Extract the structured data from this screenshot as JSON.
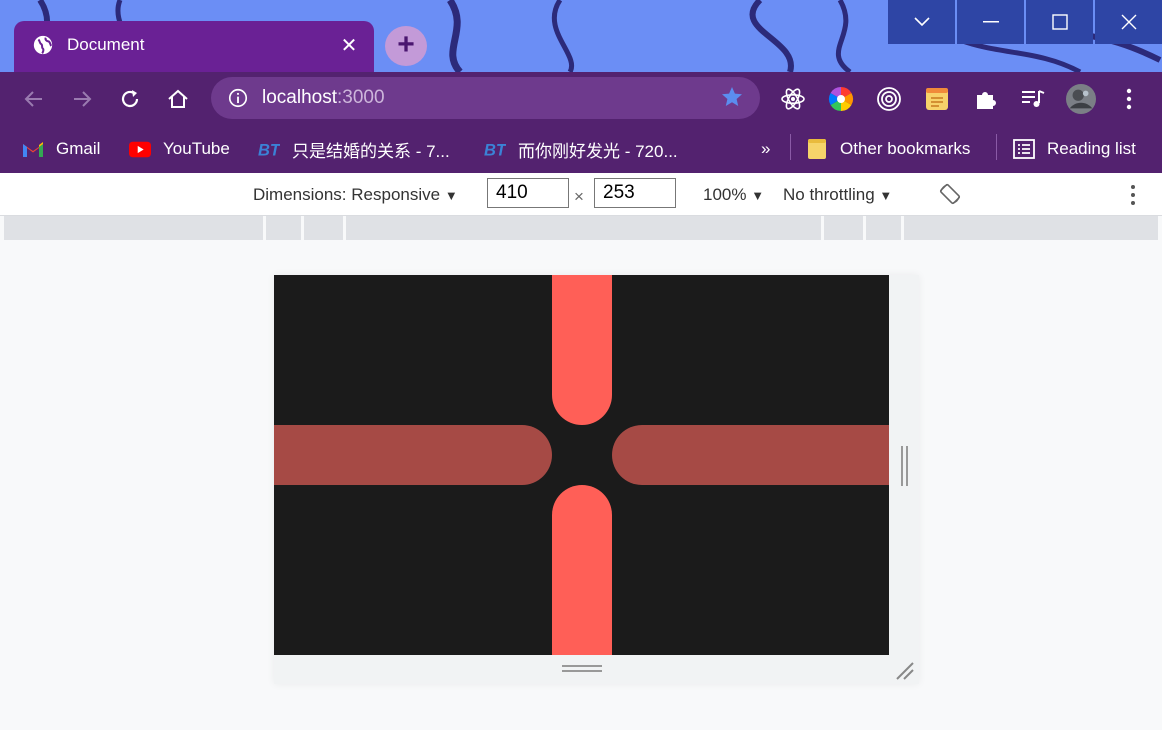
{
  "browser": {
    "tab": {
      "title": "Document",
      "close_icon": "close-icon",
      "favicon": "globe-icon"
    },
    "new_tab_icon": "plus-icon",
    "window_controls": [
      "chevron-down-icon",
      "minimize-icon",
      "maximize-icon",
      "close-icon"
    ],
    "address": {
      "host": "localhost",
      "port": ":3000"
    },
    "extensions": [
      "react-icon",
      "color-wheel-icon",
      "target-icon",
      "notes-icon",
      "puzzle-icon",
      "playlist-icon",
      "avatar",
      "more-vertical-icon"
    ]
  },
  "bookmarks": {
    "items": [
      {
        "label": "Gmail",
        "icon": "gmail-icon"
      },
      {
        "label": "YouTube",
        "icon": "youtube-icon"
      },
      {
        "label": "只是结婚的关系 - 7...",
        "icon": "bt-icon"
      },
      {
        "label": "而你刚好发光 - 720...",
        "icon": "bt-icon"
      }
    ],
    "overflow": "»",
    "other": "Other bookmarks",
    "reading_list": "Reading list"
  },
  "devtools": {
    "dimensions_label": "Dimensions: Responsive",
    "width": "410",
    "times": "×",
    "height": "253",
    "zoom": "100%",
    "throttling": "No throttling"
  },
  "colors": {
    "accent": "#6a2195",
    "toolbar": "#53226f",
    "canvas_bg": "#1b1b1b",
    "bar_bright": "#ff5f57",
    "bar_dim": "#a64a45"
  }
}
